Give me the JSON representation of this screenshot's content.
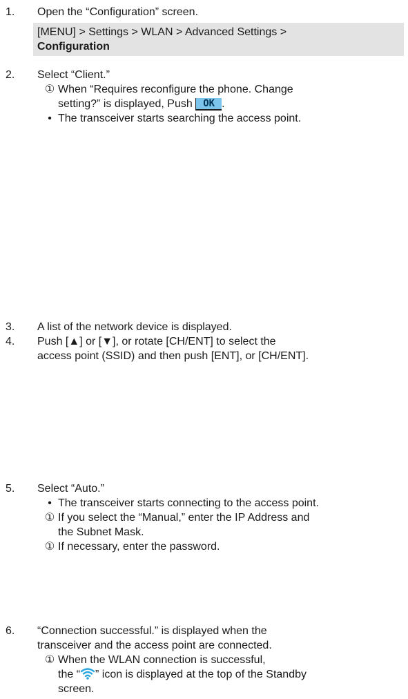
{
  "steps": [
    {
      "num": "1.",
      "text": "Open the “Configuration” screen.",
      "menu_path": "[MENU] > Settings > WLAN > Advanced Settings > ",
      "menu_target": "Configuration"
    },
    {
      "num": "2.",
      "text": "Select “Client.”",
      "note_mark": "①",
      "note_line1": "When “Requires reconfigure the phone. Change",
      "note_line2a": "setting?” is displayed, Push ",
      "note_line2b": ".",
      "key_label": "OK",
      "bullet_mark": "•",
      "bullet_text": "The transceiver starts searching the access point."
    },
    {
      "num": "3.",
      "text": "A list of the network device is displayed."
    },
    {
      "num": "4.",
      "text_line1": "Push [▲] or [▼], or rotate [CH/ENT] to select the",
      "text_line2": "access point (SSID) and then push [ENT], or [CH/ENT]."
    },
    {
      "num": "5.",
      "text": "Select “Auto.”",
      "bullet_mark": "•",
      "bullet_text": "The transceiver starts connecting to the access point.",
      "note1_mark": "①",
      "note1_line1": "If you select the “Manual,” enter the IP Address and",
      "note1_line2": "the Subnet Mask.",
      "note2_mark": "①",
      "note2_text": "If necessary, enter the password."
    },
    {
      "num": "6.",
      "text_line1": "“Connection successful.” is displayed when the",
      "text_line2": "transceiver and the access point are connected.",
      "note_mark": "①",
      "note_line1": "When the WLAN connection is successful,",
      "note_line2a": "the “",
      "note_line2b": "” icon is displayed at the top of the Standby",
      "note_line3": "screen.",
      "icon": "wifi-icon"
    }
  ],
  "colors": {
    "menu_bg": "#e3e3e3",
    "key_bg": "#7cc4ec",
    "wifi_icon": "#2aa7e0"
  }
}
